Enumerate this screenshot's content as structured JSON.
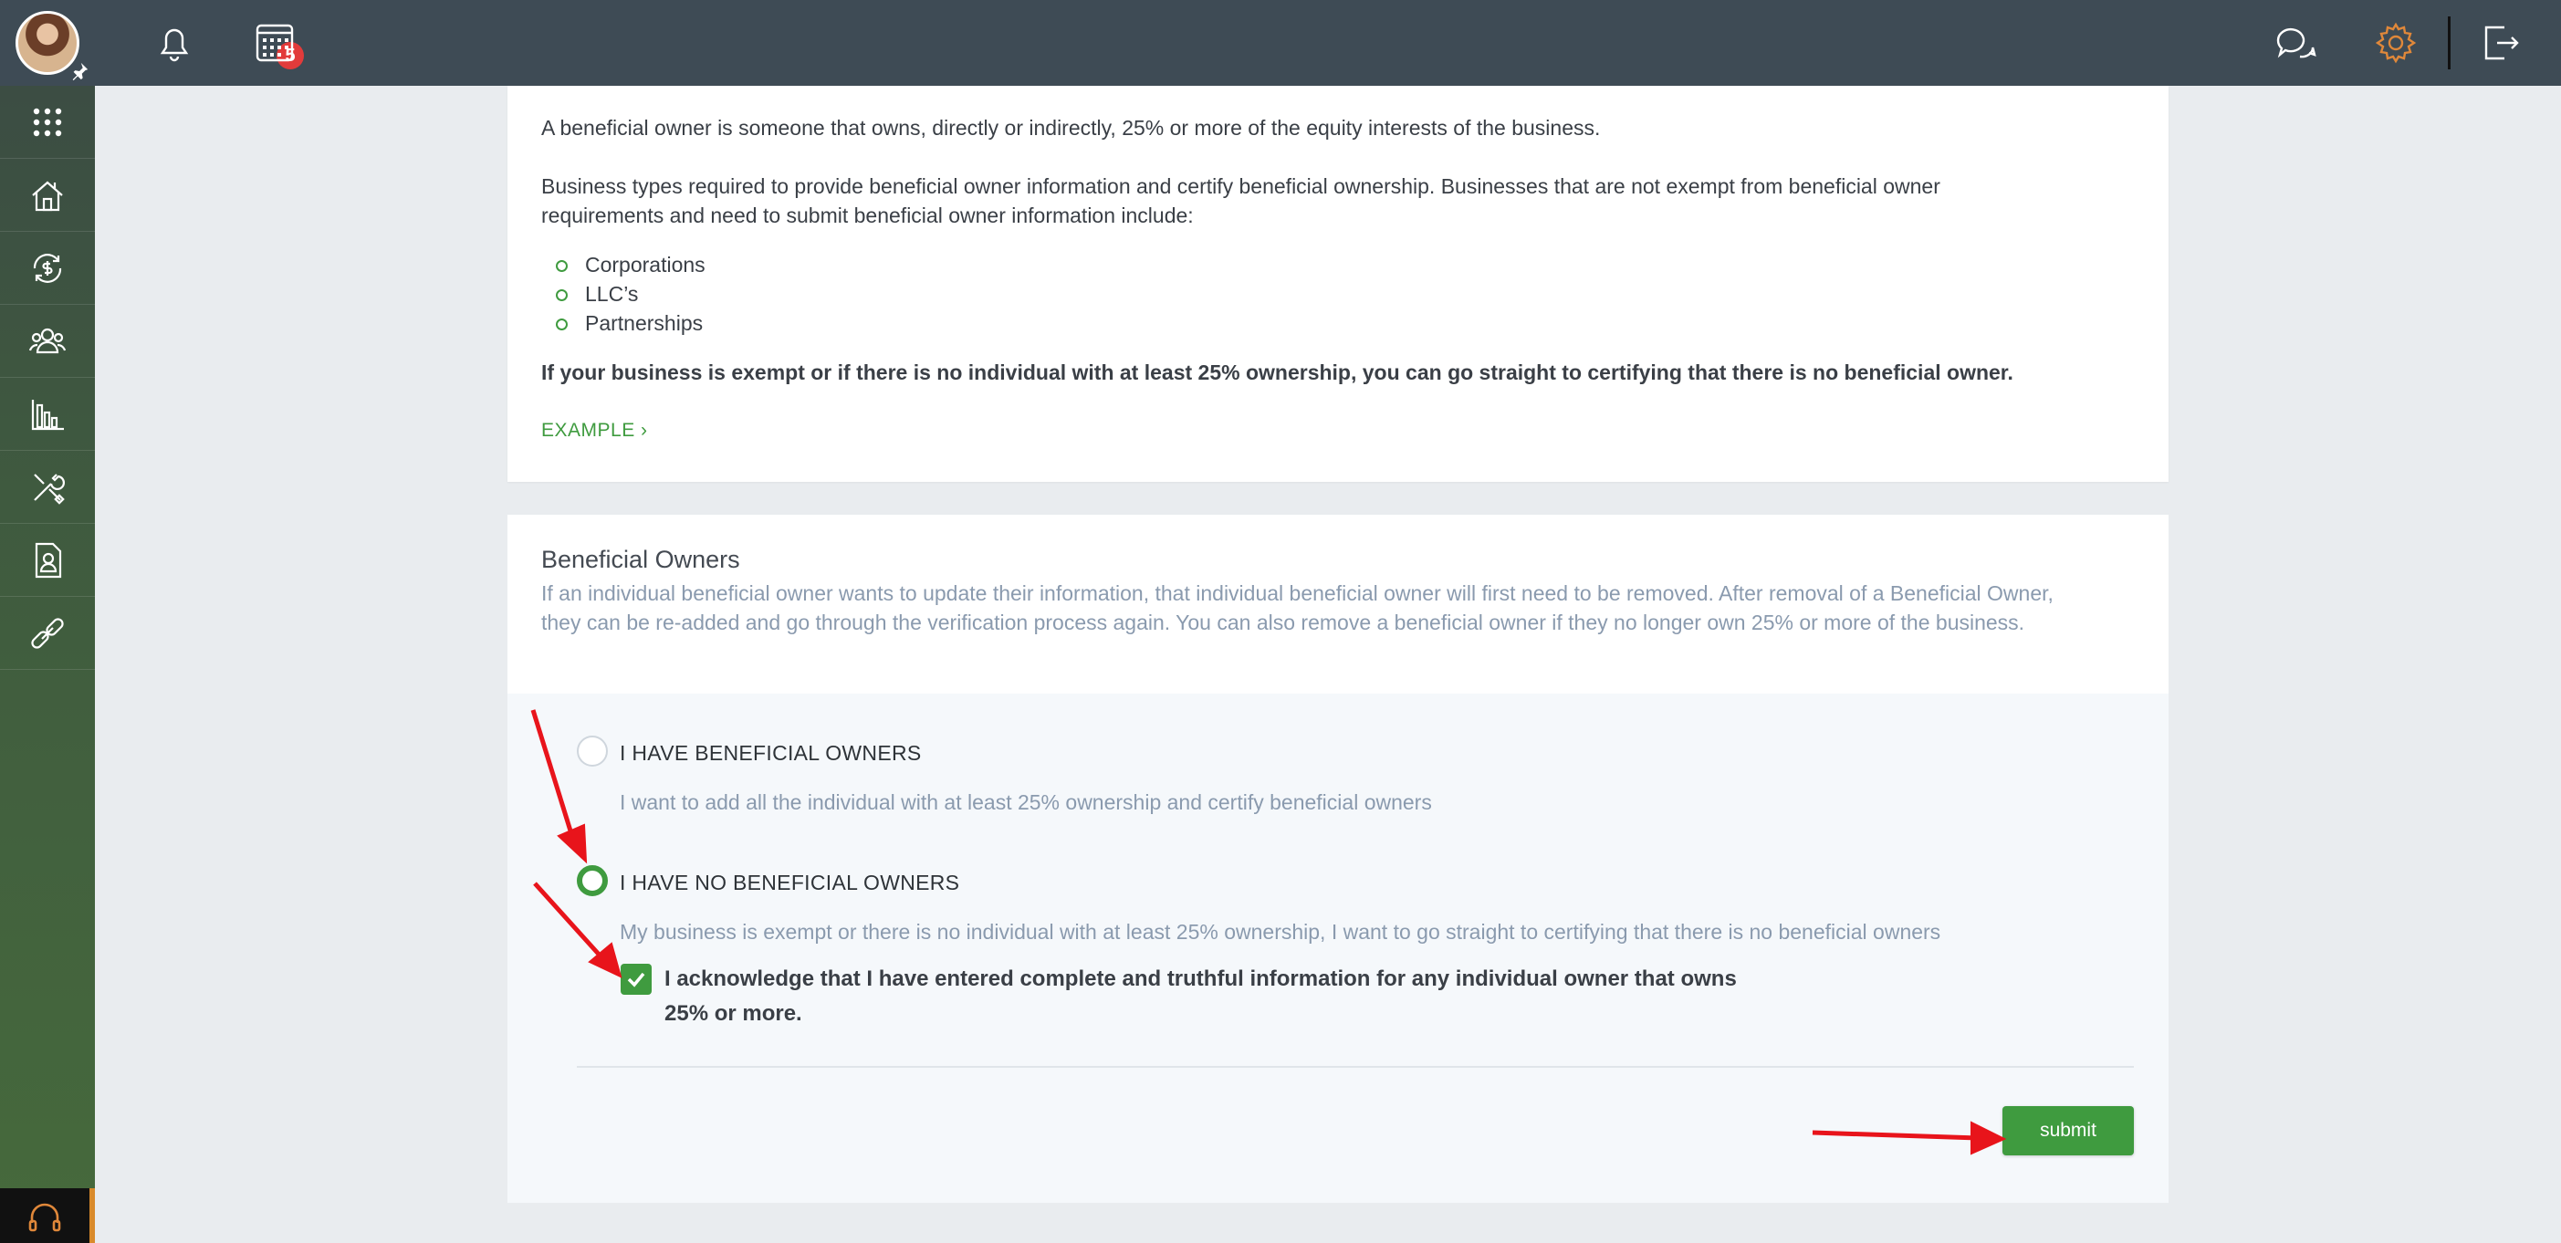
{
  "topbar": {
    "notification_count": "5"
  },
  "intro": {
    "p1": "A beneficial owner is someone that owns, directly or indirectly, 25% or more of the equity interests of the business.",
    "p2_line1": "Business types required to provide beneficial owner information and certify beneficial ownership. Businesses that are not exempt from beneficial owner",
    "p2_line2": "requirements and need to submit beneficial owner information include:",
    "bullets": [
      "Corporations",
      "LLC’s",
      "Partnerships"
    ],
    "bold_note": "If your business is exempt or if there is no individual with at least 25% ownership, you can go straight to certifying that there is no beneficial owner.",
    "example_link": "EXAMPLE ›"
  },
  "beneficial_owners": {
    "title": "Beneficial Owners",
    "description": "If an individual beneficial owner wants to update their information, that individual beneficial owner will first need to be removed. After removal of a Beneficial Owner, they can be re-added and go through the verification process again. You can also remove a beneficial owner if they no longer own 25% or more of the business.",
    "options": [
      {
        "label": "I HAVE BENEFICIAL OWNERS",
        "description": "I want to add all the individual with at least 25% ownership and certify beneficial owners",
        "selected": false
      },
      {
        "label": "I HAVE NO BENEFICIAL OWNERS",
        "description": "My business is exempt or there is no individual with at least 25% ownership, I want to go straight to certifying that there is no beneficial owners",
        "selected": true
      }
    ],
    "acknowledge": {
      "line1": "I acknowledge that I have entered complete and truthful information for any individual owner that owns",
      "line2": "25% or more.",
      "checked": true
    },
    "submit_label": "submit"
  },
  "colors": {
    "accent": "#3f9b3f",
    "topbar": "#3e4b55",
    "badge": "#e23b3b",
    "settings_icon": "#e0883a",
    "annotation_arrow": "#e8141b"
  }
}
